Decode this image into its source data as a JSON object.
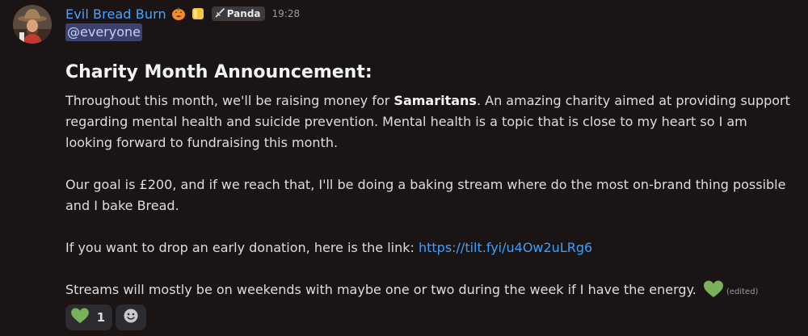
{
  "message": {
    "username": "Evil Bread Burn",
    "role_icons": [
      "jack-o-lantern-icon",
      "gold-badge-icon"
    ],
    "server_tag": {
      "icon": "sword-icon",
      "label": "Panda"
    },
    "timestamp": "19:28",
    "mention": "@everyone",
    "heading": "Charity Month Announcement:",
    "paragraph1": {
      "before": "Throughout this month, we'll be raising money for ",
      "bold": "Samaritans",
      "after": ". An amazing charity aimed at providing support regarding mental health and suicide prevention. Mental health is a topic that is close to my heart so I am looking forward to fundraising this month."
    },
    "paragraph2": "Our goal is £200, and if we reach that, I'll be doing a baking stream where do the most on-brand thing possible and I bake Bread.",
    "paragraph3": {
      "before": "If you want to drop an early donation, here is the link: ",
      "link": "https://tilt.fyi/u4Ow2uLRg6"
    },
    "paragraph4": {
      "text": "Streams will mostly be on weekends with maybe one or two during the week if I have the energy. ",
      "emoji": "green-heart-icon"
    },
    "edited_label": "(edited)"
  },
  "reactions": [
    {
      "emoji": "green-heart-icon",
      "count": "1"
    }
  ],
  "add_reaction": {
    "icon": "smiley-add-icon"
  },
  "colors": {
    "background": "#1a1514",
    "username": "#4aa3ff",
    "link": "#3aa0ff",
    "mention_bg": "#3c4270",
    "heart": "#78b159"
  }
}
